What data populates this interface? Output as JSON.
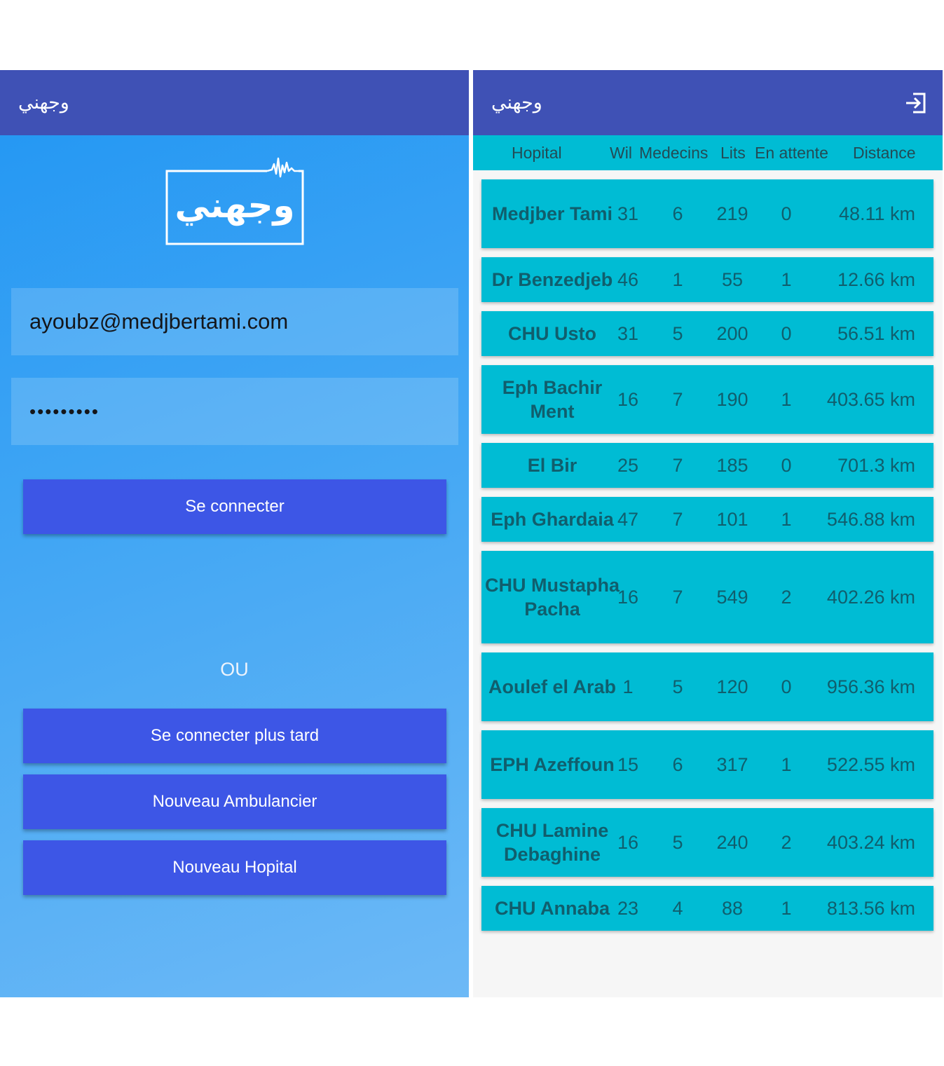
{
  "app": {
    "title": "وجهني"
  },
  "login": {
    "logo_text": "وجهني",
    "email_value": "ayoubz@medjbertami.com",
    "password_value": "•••••••••",
    "login_label": "Se connecter",
    "or_label": "OU",
    "later_label": "Se connecter plus tard",
    "ambulancier_label": "Nouveau Ambulancier",
    "hospital_label": "Nouveau Hopital"
  },
  "list": {
    "logout_icon": "logout-icon",
    "headers": {
      "hospital": "Hopital",
      "wil": "Wil",
      "medecins": "Medecins",
      "lits": "Lits",
      "waiting": "En attente",
      "distance": "Distance"
    },
    "hospitals": [
      {
        "name": "Medjber Tami",
        "wil": "31",
        "medecins": "6",
        "lits": "219",
        "waiting": "0",
        "distance": "48.11 km"
      },
      {
        "name": "Dr Benzedjeb",
        "wil": "46",
        "medecins": "1",
        "lits": "55",
        "waiting": "1",
        "distance": "12.66 km"
      },
      {
        "name": "CHU Usto",
        "wil": "31",
        "medecins": "5",
        "lits": "200",
        "waiting": "0",
        "distance": "56.51 km"
      },
      {
        "name": "Eph Bachir Ment",
        "wil": "16",
        "medecins": "7",
        "lits": "190",
        "waiting": "1",
        "distance": "403.65 km"
      },
      {
        "name": "El Bir",
        "wil": "25",
        "medecins": "7",
        "lits": "185",
        "waiting": "0",
        "distance": "701.3 km"
      },
      {
        "name": "Eph Ghardaia",
        "wil": "47",
        "medecins": "7",
        "lits": "101",
        "waiting": "1",
        "distance": "546.88 km"
      },
      {
        "name": "CHU Mustapha Pacha",
        "wil": "16",
        "medecins": "7",
        "lits": "549",
        "waiting": "2",
        "distance": "402.26 km"
      },
      {
        "name": "Aoulef el Arab",
        "wil": "1",
        "medecins": "5",
        "lits": "120",
        "waiting": "0",
        "distance": "956.36 km"
      },
      {
        "name": "EPH Azeffoun",
        "wil": "15",
        "medecins": "6",
        "lits": "317",
        "waiting": "1",
        "distance": "522.55 km"
      },
      {
        "name": "CHU Lamine Debaghine",
        "wil": "16",
        "medecins": "5",
        "lits": "240",
        "waiting": "2",
        "distance": "403.24 km"
      },
      {
        "name": "CHU Annaba",
        "wil": "23",
        "medecins": "4",
        "lits": "88",
        "waiting": "1",
        "distance": "813.56 km"
      }
    ]
  }
}
